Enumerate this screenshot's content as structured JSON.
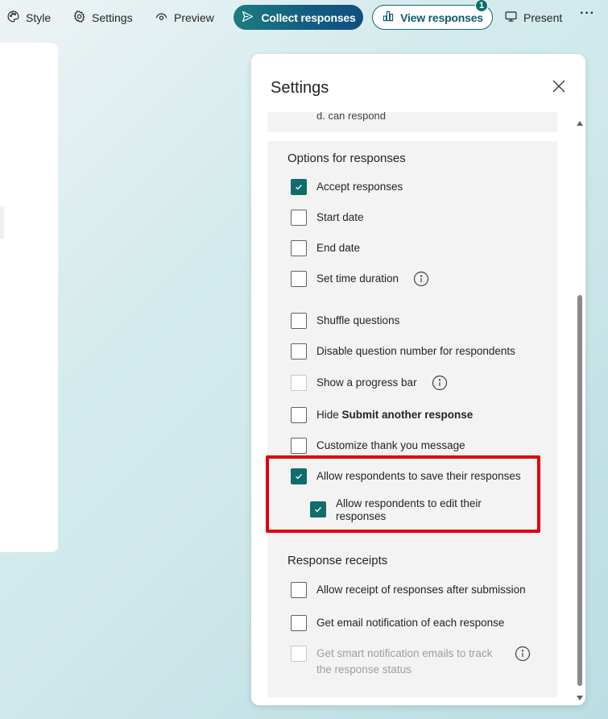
{
  "toolbar": {
    "style_label": "Style",
    "settings_label": "Settings",
    "preview_label": "Preview",
    "collect_label": "Collect responses",
    "view_label": "View responses",
    "view_badge": "1",
    "present_label": "Present",
    "more_label": "···"
  },
  "panel": {
    "title": "Settings",
    "prev_fragment": "d. can respond",
    "responses_section": {
      "title": "Options for responses",
      "accept": "Accept responses",
      "start_date": "Start date",
      "end_date": "End date",
      "time_duration": "Set time duration",
      "shuffle": "Shuffle questions",
      "disable_number": "Disable question number for respondents",
      "progress_bar": "Show a progress bar",
      "hide_prefix": "Hide ",
      "hide_bold": "Submit another response",
      "thank_you": "Customize thank you message",
      "save": "Allow respondents to save their responses",
      "edit": "Allow respondents to edit their responses"
    },
    "receipts_section": {
      "title": "Response receipts",
      "receipt": "Allow receipt of responses after submission",
      "email_notify": "Get email notification of each response",
      "smart_notify": "Get smart notification emails to track the response status"
    }
  },
  "colors": {
    "accent": "#0f6d6e",
    "highlight": "#e0000f"
  }
}
